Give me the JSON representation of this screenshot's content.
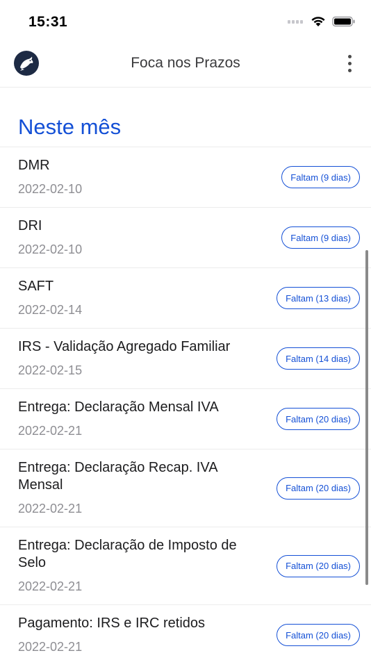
{
  "status_bar": {
    "time": "15:31"
  },
  "app_bar": {
    "title": "Foca nos Prazos",
    "logo_icon": "seal-logo-icon",
    "menu_icon": "more-vertical-icon"
  },
  "section": {
    "title": "Neste mês"
  },
  "items": [
    {
      "title": "DMR",
      "date": "2022-02-10",
      "badge": "Faltam (9 dias)"
    },
    {
      "title": "DRI",
      "date": "2022-02-10",
      "badge": "Faltam (9 dias)"
    },
    {
      "title": "SAFT",
      "date": "2022-02-14",
      "badge": "Faltam (13 dias)"
    },
    {
      "title": "IRS - Validação Agregado Familiar",
      "date": "2022-02-15",
      "badge": "Faltam (14 dias)"
    },
    {
      "title": "Entrega: Declaração Mensal IVA",
      "date": "2022-02-21",
      "badge": "Faltam (20 dias)"
    },
    {
      "title": "Entrega: Declaração Recap. IVA Mensal",
      "date": "2022-02-21",
      "badge": "Faltam (20 dias)"
    },
    {
      "title": "Entrega: Declaração de Imposto de Selo",
      "date": "2022-02-21",
      "badge": "Faltam (20 dias)"
    },
    {
      "title": "Pagamento: IRS e IRC retidos",
      "date": "2022-02-21",
      "badge": "Faltam (20 dias)"
    }
  ],
  "colors": {
    "accent": "#1450d6",
    "logo_bg": "#1d2a44",
    "date_text": "#8e8e93"
  }
}
